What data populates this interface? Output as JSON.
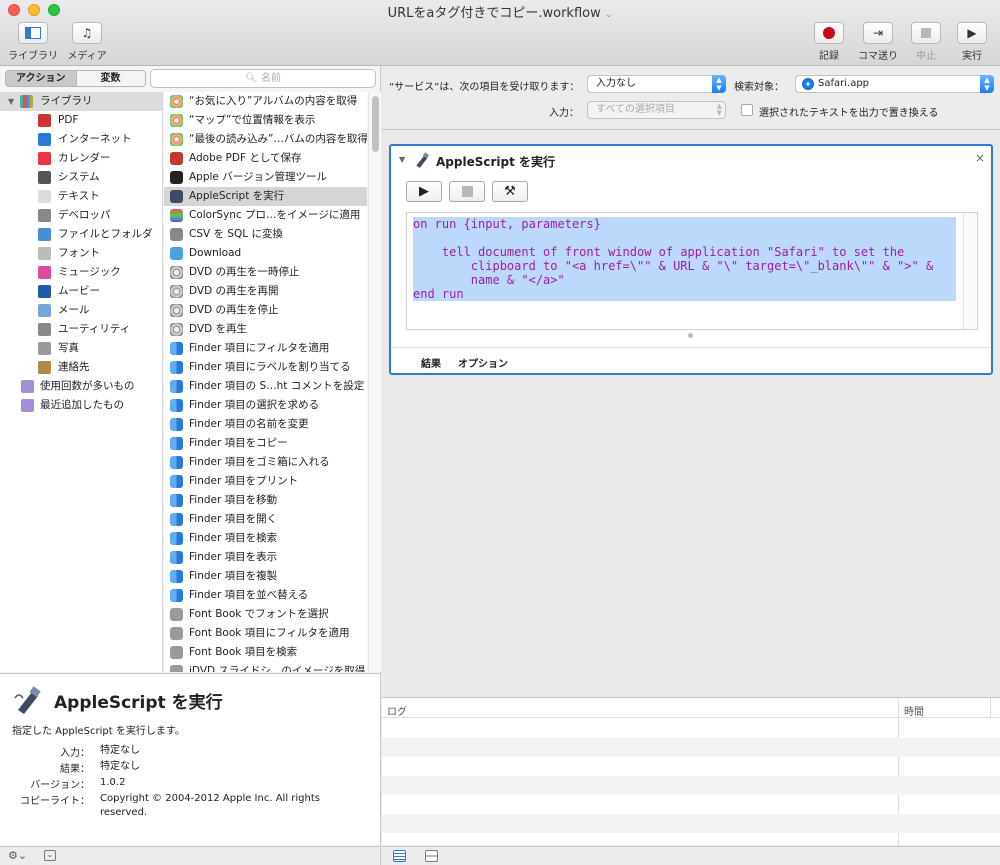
{
  "window": {
    "title": "URLをaタグ付きでコピー.workflow"
  },
  "toolbar": {
    "left_buttons": [
      {
        "label": "ライブラリ"
      },
      {
        "label": "メディア"
      }
    ],
    "right_buttons": [
      {
        "label": "記録"
      },
      {
        "label": "コマ送り"
      },
      {
        "label": "中止"
      },
      {
        "label": "実行"
      }
    ]
  },
  "left": {
    "segments": [
      "アクション",
      "変数"
    ],
    "search_placeholder": "名前",
    "library_label": "ライブラリ",
    "categories": [
      "PDF",
      "インターネット",
      "カレンダー",
      "システム",
      "テキスト",
      "デベロッパ",
      "ファイルとフォルダ",
      "フォント",
      "ミュージック",
      "ムービー",
      "メール",
      "ユーティリティ",
      "写真",
      "連絡先"
    ],
    "smart_groups": [
      "使用回数が多いもの",
      "最近追加したもの"
    ],
    "actions": [
      "“お気に入り”アルバムの内容を取得",
      "“マップ”で位置情報を表示",
      "“最後の読み込み”…バムの内容を取得",
      "Adobe PDF として保存",
      "Apple バージョン管理ツール",
      "AppleScript を実行",
      "ColorSync プロ…をイメージに適用",
      "CSV を SQL に変換",
      "Download",
      "DVD の再生を一時停止",
      "DVD の再生を再開",
      "DVD の再生を停止",
      "DVD を再生",
      "Finder 項目にフィルタを適用",
      "Finder 項目にラベルを割り当てる",
      "Finder 項目の S…ht コメントを設定",
      "Finder 項目の選択を求める",
      "Finder 項目の名前を変更",
      "Finder 項目をコピー",
      "Finder 項目をゴミ箱に入れる",
      "Finder 項目をプリント",
      "Finder 項目を移動",
      "Finder 項目を開く",
      "Finder 項目を検索",
      "Finder 項目を表示",
      "Finder 項目を複製",
      "Finder 項目を並べ替える",
      "Font Book でフォントを選択",
      "Font Book 項目にフィルタを適用",
      "Font Book 項目を検索",
      "iDVD スライドシ…のイメージを取得"
    ],
    "selected_action": "AppleScript を実行",
    "description": {
      "title": "AppleScript を実行",
      "text": "指定した AppleScript を実行します。",
      "rows": [
        {
          "key": "入力：",
          "value": "特定なし"
        },
        {
          "key": "結果：",
          "value": "特定なし"
        },
        {
          "key": "バージョン：",
          "value": "1.0.2"
        },
        {
          "key": "コピーライト：",
          "value": "Copyright © 2004-2012 Apple Inc.  All rights reserved."
        }
      ]
    }
  },
  "service": {
    "receives_label": "“サービス”は、次の項目を受け取ります：",
    "receives_value": "入力なし",
    "target_label": "検索対象：",
    "target_value": "Safari.app",
    "input_label": "入力：",
    "input_value": "すべての選択項目",
    "replace_label": "選択されたテキストを出力で置き換える"
  },
  "action_card": {
    "title": "AppleScript を実行",
    "code": "on run {input, parameters}\n\n    tell document of front window of application \"Safari\" to set the\n        clipboard to \"<a href=\\\"\" & URL & \"\\\" target=\\\"_blank\\\"\" & \">\" &\n        name & \"</a>\"\nend run",
    "footer_tabs": [
      "結果",
      "オプション"
    ]
  },
  "log": {
    "col_log": "ログ",
    "col_time": "時間"
  },
  "colors": {
    "accent": "#2e78d6",
    "record": "#d0011b",
    "selection": "#bcd8fb",
    "code_text": "#9b1ea6"
  }
}
